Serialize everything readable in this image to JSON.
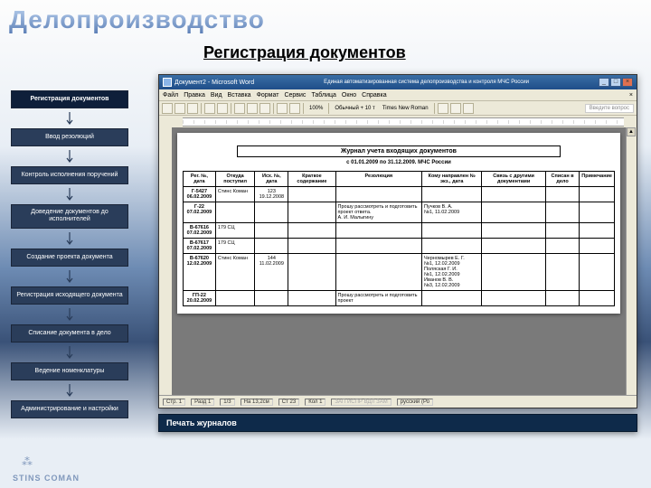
{
  "main_title": "Делопроизводство",
  "section_title": "Регистрация документов",
  "nav": [
    "Регистрация документов",
    "Ввод резолюций",
    "Контроль исполнения поручений",
    "Доведение документов до исполнителей",
    "Создание проекта документа",
    "Регистрация исходящего документа",
    "Списание документа в дело",
    "Ведение номенклатуры",
    "Администрирование и настройки"
  ],
  "word": {
    "title": "Документ2 - Microsoft Word",
    "system_title": "Единая автоматизированная система делопроизводства и контроля МЧС России",
    "menu": [
      "Файл",
      "Правка",
      "Вид",
      "Вставка",
      "Формат",
      "Сервис",
      "Таблица",
      "Окно",
      "Справка"
    ],
    "help_placeholder": "Введите вопрос",
    "style": "Обычный + 10 т",
    "font": "Times New Roman",
    "doc_title": "Журнал учета входящих документов",
    "doc_sub": "с 01.01.2009 по 31.12.2009. МЧС России",
    "columns": [
      "Рег. №, дата",
      "Откуда поступил",
      "Исх. №, дата",
      "Краткое содержание",
      "Резолюция",
      "Кому направлен № экз., дата",
      "Связь с другими документами",
      "Списан в дело",
      "Примечание"
    ],
    "rows": [
      {
        "reg": "Г-5427\n06.02.2009",
        "from": "Стинс Коман",
        "out": "123\n19.12.2008",
        "sum": "",
        "res": "",
        "to": "",
        "link": "",
        "off": "",
        "note": ""
      },
      {
        "reg": "Г-22\n07.02.2009",
        "from": "",
        "out": "",
        "sum": "",
        "res": "Прошу рассмотреть и подготовить проект ответа.\nА. И. Малыгину",
        "to": "Пучков В. А.\n№1, 11.02.2009",
        "link": "",
        "off": "",
        "note": ""
      },
      {
        "reg": "В-67616\n07.02.2009",
        "from": "179 СЦ",
        "out": "",
        "sum": "",
        "res": "",
        "to": "",
        "link": "",
        "off": "",
        "note": ""
      },
      {
        "reg": "В-67617\n07.02.2009",
        "from": "179 СЦ",
        "out": "",
        "sum": "",
        "res": "",
        "to": "",
        "link": "",
        "off": "",
        "note": ""
      },
      {
        "reg": "В-67620\n12.02.2009",
        "from": "Стинс Коман",
        "out": "144\n11.02.2009",
        "sum": "",
        "res": "",
        "to": "Черномырев Е. Г.\n№1, 12.02.2009\nПоляская Г. И.\n№1, 12.02.2009\nИванов В. В.\n№3, 12.02.2009",
        "link": "",
        "off": "",
        "note": ""
      },
      {
        "reg": "ГП-22\n20.02.2009",
        "from": "",
        "out": "",
        "sum": "",
        "res": "Прошу рассмотреть и подготовить проект",
        "to": "",
        "link": "",
        "off": "",
        "note": ""
      }
    ],
    "status": {
      "page": "Стр. 1",
      "sec": "Разд 1",
      "pages": "1/3",
      "at": "На 13,2см",
      "ln": "Ст 23",
      "col": "Кол 1",
      "flags": "ЗАП  ИСПР  ВДЛ  ЗАМ",
      "lang": "русский (Ро"
    }
  },
  "caption": "Печать журналов",
  "brand": "STINS  COMAN"
}
